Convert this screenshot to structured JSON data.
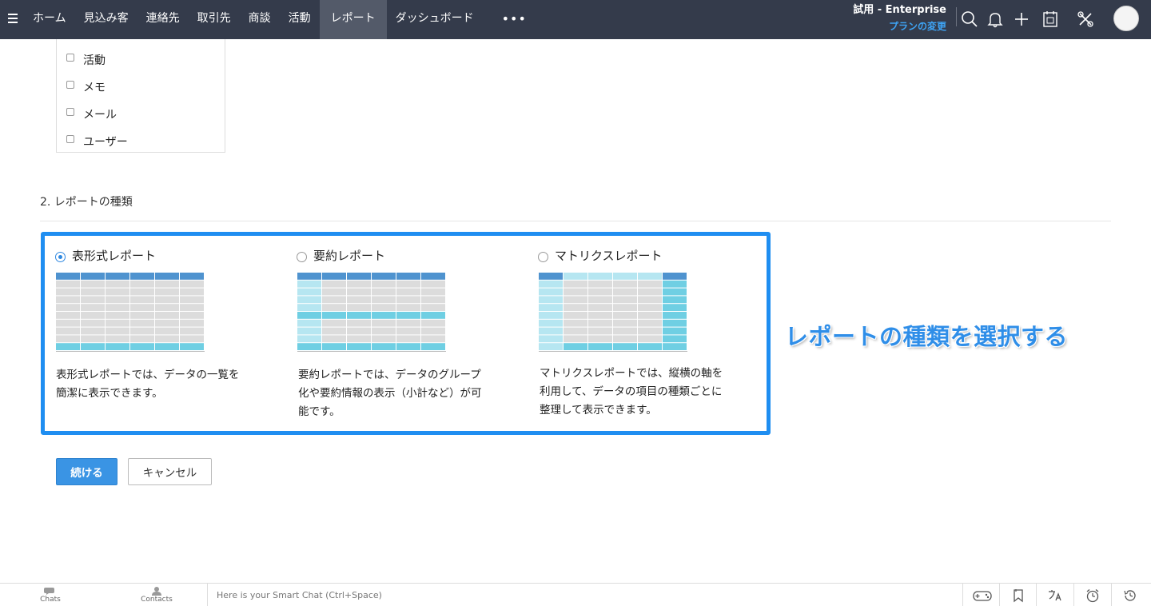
{
  "nav": {
    "items": [
      "ホーム",
      "見込み客",
      "連絡先",
      "取引先",
      "商談",
      "活動",
      "レポート",
      "ダッシュボード"
    ],
    "more": "•••",
    "active_index": 6
  },
  "trial": {
    "edition": "試用 - Enterprise",
    "change_plan": "プランの変更"
  },
  "icons": {
    "top": [
      "search-icon",
      "bell-icon",
      "plus-icon",
      "calendar-icon",
      "tools-icon",
      "avatar"
    ],
    "bottom": [
      "gamepad-icon",
      "bookmark-icon",
      "translate-icon",
      "alarm-clock-icon",
      "history-icon"
    ]
  },
  "entities": [
    "活動",
    "メモ",
    "メール",
    "ユーザー"
  ],
  "section": {
    "title": "2.  レポートの種類"
  },
  "report_types": [
    {
      "label": "表形式レポート",
      "checked": true,
      "description": [
        "表形式レポートでは、データの一覧を",
        "簡潔に表示できます。"
      ]
    },
    {
      "label": "要約レポート",
      "checked": false,
      "description": [
        "要約レポートでは、データのグループ",
        "化や要約情報の表示（小計など）が可",
        "能です。"
      ]
    },
    {
      "label": "マトリクスレポート",
      "checked": false,
      "description": [
        "マトリクスレポートでは、縦横の軸を",
        "利用して、データの項目の種類ごとに",
        "整理して表示できます。"
      ]
    }
  ],
  "annotation": "レポートの種類を選択する",
  "buttons": {
    "continue": "続ける",
    "cancel": "キャンセル"
  },
  "bottombar": {
    "chats": "Chats",
    "contacts": "Contacts",
    "smart_chat_placeholder": "Here is your Smart Chat (Ctrl+Space)"
  },
  "colors": {
    "nav_bg": "#343b4b",
    "accent": "#1f8ef1",
    "grid_header": "#4f93cf",
    "grid_cell": "#dcdcdc",
    "grid_highlight": "#6fcfe3",
    "grid_light": "#b6e6f1"
  }
}
